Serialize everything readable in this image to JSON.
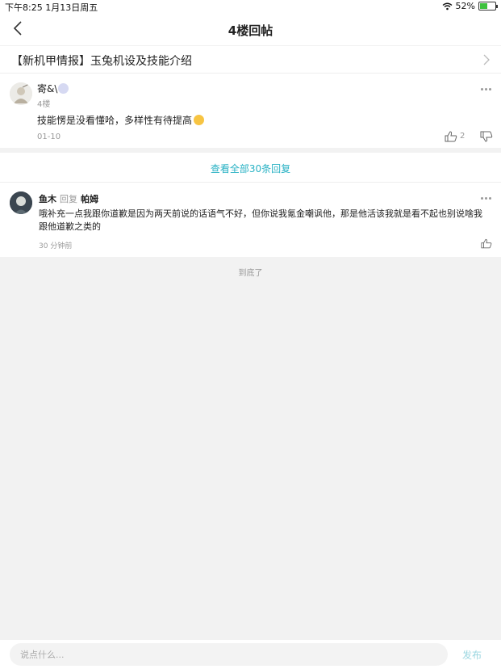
{
  "status_bar": {
    "time_date": "下午8:25   1月13日周五",
    "battery": "52%"
  },
  "nav": {
    "title": "4楼回帖"
  },
  "thread": {
    "title": "【新机甲情报】玉兔机设及技能介绍"
  },
  "post": {
    "username": "寄&\\",
    "floor": "4楼",
    "content": "技能愣是没看懂哈，多样性有待提高",
    "date": "01-10",
    "like_count": "2"
  },
  "view_all": {
    "label": "查看全部30条回复"
  },
  "reply": {
    "username": "鱼木",
    "reply_word": "回复",
    "target": "帕姆",
    "content": "哦补充一点我跟你道歉是因为两天前说的话语气不好，但你说我氪金嘲讽他，那是他活该我就是看不起也别说啥我跟他道歉之类的",
    "time": "30 分钟前"
  },
  "end_label": "到底了",
  "composer": {
    "placeholder": "说点什么...",
    "publish_label": "发布"
  }
}
